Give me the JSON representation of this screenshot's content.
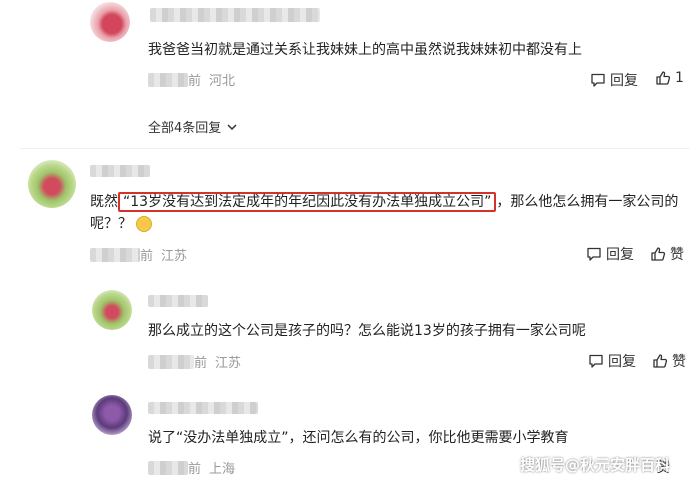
{
  "comments": [
    {
      "text": "我爸爸当初就是通过关系让我妹妹上的高中虽然说我妹妹初中都没有上",
      "time_suffix": "前",
      "location": "河北",
      "reply_label": "回复",
      "like_count": "1",
      "expand_label": "全部4条回复"
    },
    {
      "text_before": "既然",
      "text_highlight": "“13岁没有达到法定成年的年纪因此没有办法单独成立公司”",
      "text_after_line1": "，那么他怎么拥有一家公司的",
      "text_line2": "呢？？",
      "time_suffix": "前",
      "location": "江苏",
      "reply_label": "回复",
      "like_label": "赞"
    },
    {
      "text": "那么成立的这个公司是孩子的吗？怎么能说13岁的孩子拥有一家公司呢",
      "time_suffix": "前",
      "location": "江苏",
      "reply_label": "回复",
      "like_label": "赞"
    },
    {
      "text": "说了“没办法单独成立”，还问怎么有的公司，你比他更需要小学教育",
      "time_suffix": "前",
      "location": "上海",
      "like_label": "赞"
    }
  ],
  "watermark": "搜狐号@秋元安胖百科",
  "colors": {
    "highlight_border": "#d6312b",
    "meta_gray": "#999999"
  }
}
